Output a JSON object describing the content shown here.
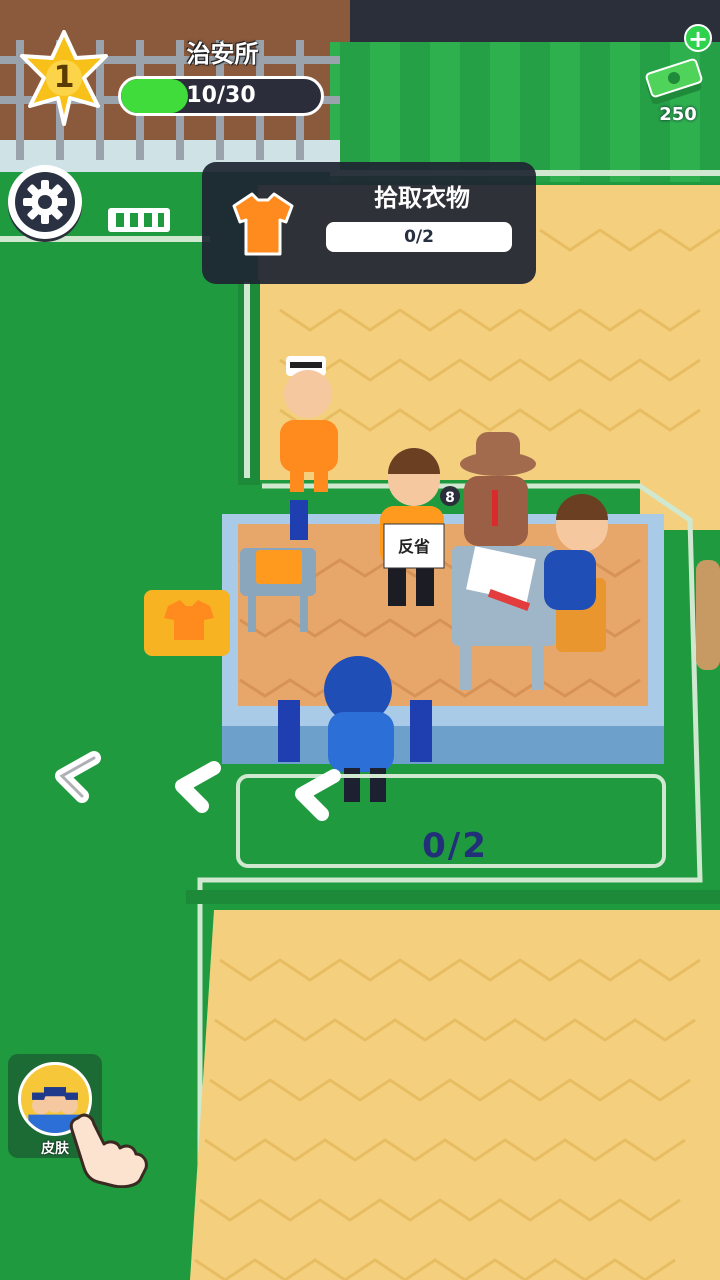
{
  "hud": {
    "level": "1",
    "area_title": "治安所",
    "progress_text": "10/30",
    "progress_fraction": 0.333,
    "cash_value": "250",
    "cash_plus": "+"
  },
  "task": {
    "title": "拾取衣物",
    "count": "0/2",
    "icon": "orange-shirt-icon"
  },
  "scene": {
    "zone_count": "0/2",
    "sign_text": "反省",
    "badge_number": "8"
  },
  "skin_button": {
    "label": "皮肤"
  },
  "colors": {
    "grass": "#1f9a3e",
    "floor": "#f3cf7e",
    "accent_green": "#3fdc3c",
    "prisoner_orange": "#ff8a1e",
    "police_blue": "#1f4fb6",
    "panel_dark": "#1e2432"
  }
}
